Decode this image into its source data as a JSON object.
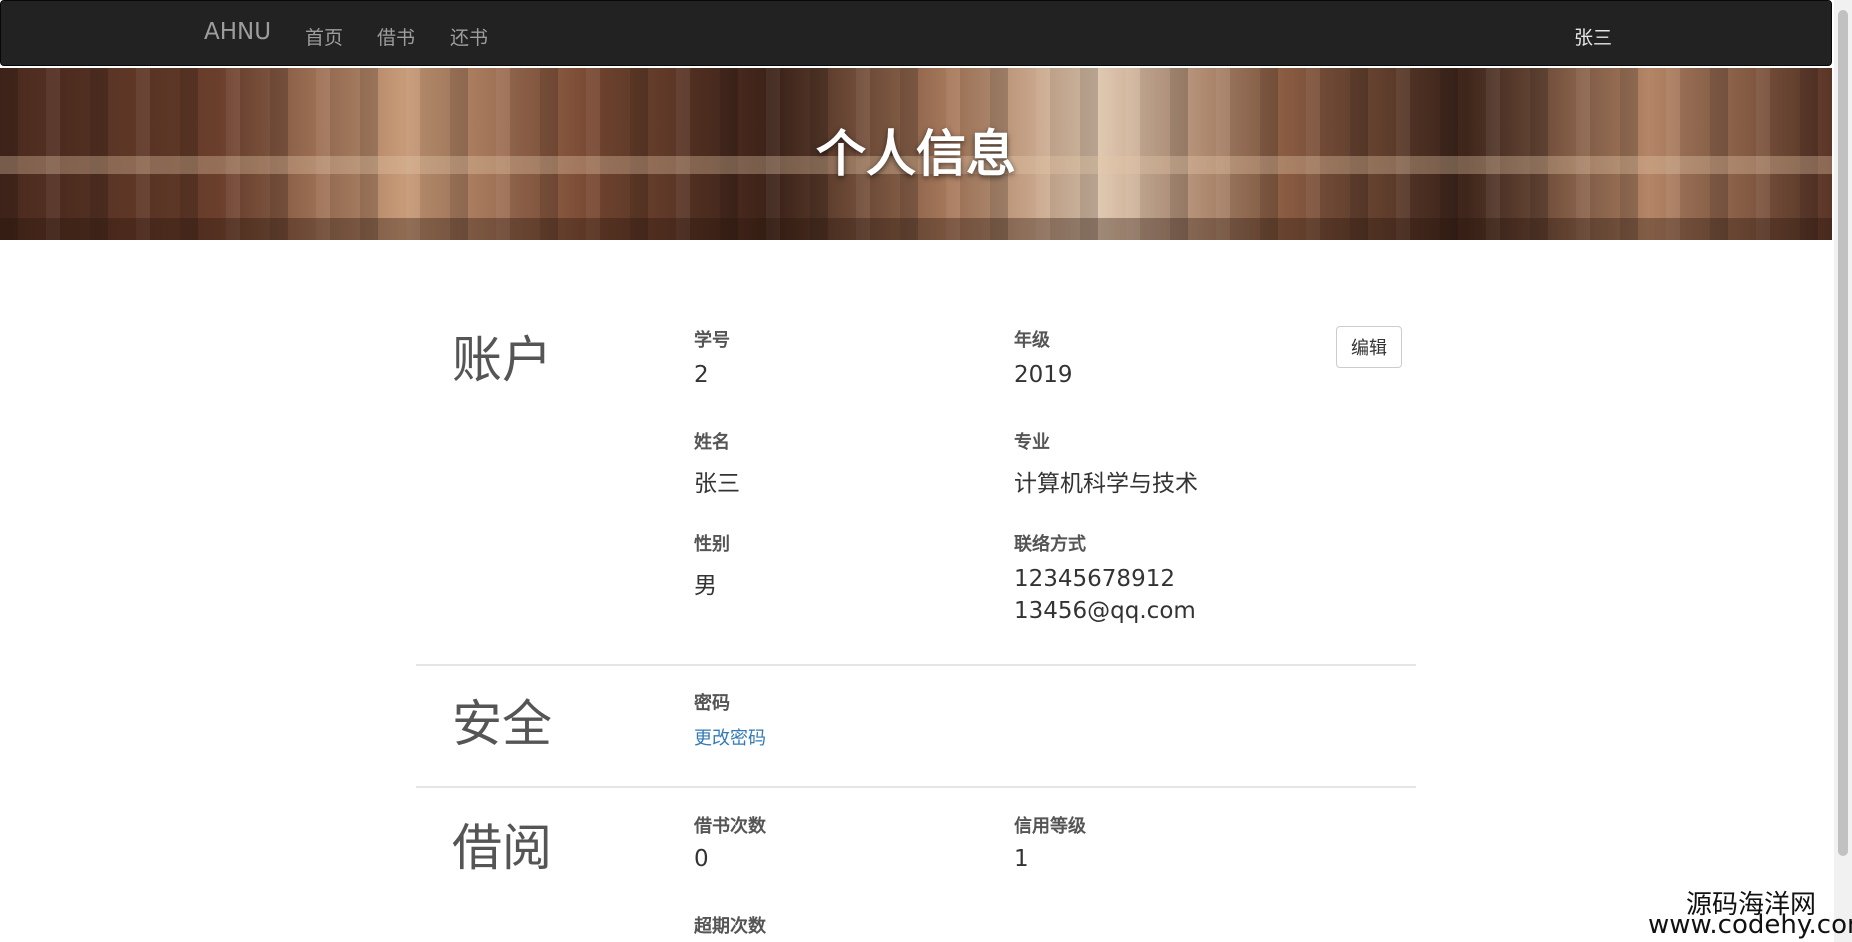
{
  "navbar": {
    "brand": "AHNU",
    "links": [
      "首页",
      "借书",
      "还书"
    ],
    "user": "张三"
  },
  "banner": {
    "title": "个人信息"
  },
  "account": {
    "title": "账户",
    "edit_label": "编辑",
    "student_id": {
      "label": "学号",
      "value": "2"
    },
    "grade": {
      "label": "年级",
      "value": "2019"
    },
    "name": {
      "label": "姓名",
      "value": "张三"
    },
    "major": {
      "label": "专业",
      "value": "计算机科学与技术"
    },
    "gender": {
      "label": "性别",
      "value": "男"
    },
    "contact": {
      "label": "联络方式",
      "phone": "12345678912",
      "email": "13456@qq.com"
    }
  },
  "security": {
    "title": "安全",
    "password_label": "密码",
    "change_password_link": "更改密码"
  },
  "borrow": {
    "title": "借阅",
    "borrow_count": {
      "label": "借书次数",
      "value": "0"
    },
    "credit_level": {
      "label": "信用等级",
      "value": "1"
    },
    "overdue_label": "超期次数"
  },
  "watermark": {
    "line1": "源码海洋网",
    "line2": "www.codehy.com"
  }
}
